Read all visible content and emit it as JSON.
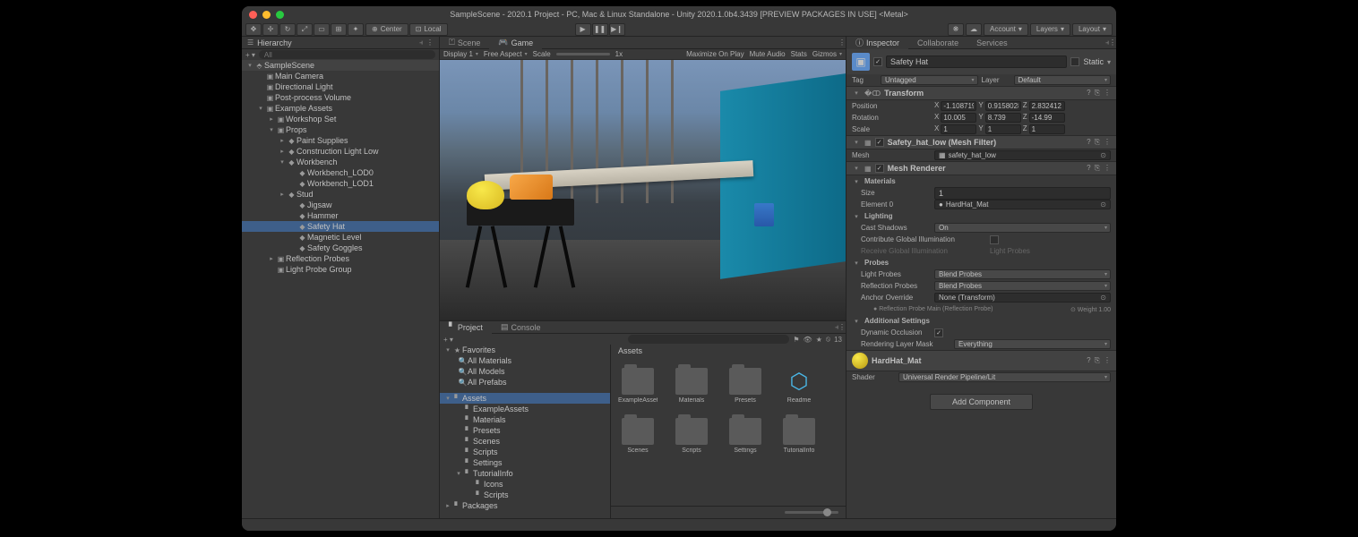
{
  "title": "SampleScene - 2020.1 Project - PC, Mac & Linux Standalone - Unity 2020.1.0b4.3439 [PREVIEW PACKAGES IN USE] <Metal>",
  "toolbar": {
    "center": "Center",
    "local": "Local",
    "account": "Account",
    "layers": "Layers",
    "layout": "Layout"
  },
  "hierarchy": {
    "title": "Hierarchy",
    "search_ph": "All",
    "items": [
      {
        "d": 0,
        "t": "▾",
        "i": "⬘",
        "l": "SampleScene",
        "hdr": true
      },
      {
        "d": 1,
        "t": "",
        "i": "▣",
        "l": "Main Camera"
      },
      {
        "d": 1,
        "t": "",
        "i": "▣",
        "l": "Directional Light"
      },
      {
        "d": 1,
        "t": "",
        "i": "▣",
        "l": "Post-process Volume"
      },
      {
        "d": 1,
        "t": "▾",
        "i": "▣",
        "l": "Example Assets"
      },
      {
        "d": 2,
        "t": "▸",
        "i": "▣",
        "l": "Workshop Set"
      },
      {
        "d": 2,
        "t": "▾",
        "i": "▣",
        "l": "Props"
      },
      {
        "d": 3,
        "t": "▸",
        "i": "◆",
        "l": "Paint Supplies"
      },
      {
        "d": 3,
        "t": "▸",
        "i": "◆",
        "l": "Construction Light Low"
      },
      {
        "d": 3,
        "t": "▾",
        "i": "◆",
        "l": "Workbench"
      },
      {
        "d": 4,
        "t": "",
        "i": "◆",
        "l": "Workbench_LOD0"
      },
      {
        "d": 4,
        "t": "",
        "i": "◆",
        "l": "Workbench_LOD1"
      },
      {
        "d": 3,
        "t": "▸",
        "i": "◆",
        "l": "Stud"
      },
      {
        "d": 4,
        "t": "",
        "i": "◆",
        "l": "Jigsaw"
      },
      {
        "d": 4,
        "t": "",
        "i": "◆",
        "l": "Hammer"
      },
      {
        "d": 4,
        "t": "",
        "i": "◆",
        "l": "Safety Hat",
        "sel": true
      },
      {
        "d": 4,
        "t": "",
        "i": "◆",
        "l": "Magnetic Level"
      },
      {
        "d": 4,
        "t": "",
        "i": "◆",
        "l": "Safety Goggles"
      },
      {
        "d": 2,
        "t": "▸",
        "i": "▣",
        "l": "Reflection Probes"
      },
      {
        "d": 2,
        "t": "",
        "i": "▣",
        "l": "Light Probe Group"
      }
    ]
  },
  "scene": {
    "tab_scene": "Scene",
    "tab_game": "Game",
    "display": "Display 1",
    "aspect": "Free Aspect",
    "scale": "Scale",
    "scale_val": "1x",
    "maximize": "Maximize On Play",
    "mute": "Mute Audio",
    "stats": "Stats",
    "gizmos": "Gizmos"
  },
  "project": {
    "tab_project": "Project",
    "tab_console": "Console",
    "count": "13",
    "favorites": "Favorites",
    "fav_items": [
      "All Materials",
      "All Models",
      "All Prefabs"
    ],
    "tree": [
      {
        "d": 0,
        "t": "▾",
        "i": "▘",
        "l": "Assets",
        "sel": true
      },
      {
        "d": 1,
        "t": "",
        "i": "▘",
        "l": "ExampleAssets"
      },
      {
        "d": 1,
        "t": "",
        "i": "▘",
        "l": "Materials"
      },
      {
        "d": 1,
        "t": "",
        "i": "▘",
        "l": "Presets"
      },
      {
        "d": 1,
        "t": "",
        "i": "▘",
        "l": "Scenes"
      },
      {
        "d": 1,
        "t": "",
        "i": "▘",
        "l": "Scripts"
      },
      {
        "d": 1,
        "t": "",
        "i": "▘",
        "l": "Settings"
      },
      {
        "d": 1,
        "t": "▾",
        "i": "▘",
        "l": "TutorialInfo"
      },
      {
        "d": 2,
        "t": "",
        "i": "▘",
        "l": "Icons"
      },
      {
        "d": 2,
        "t": "",
        "i": "▘",
        "l": "Scripts"
      },
      {
        "d": 0,
        "t": "▸",
        "i": "▘",
        "l": "Packages"
      }
    ],
    "assets_hdr": "Assets",
    "grid": [
      {
        "l": "ExampleAssets",
        "k": "folder"
      },
      {
        "l": "Materials",
        "k": "folder"
      },
      {
        "l": "Presets",
        "k": "folder"
      },
      {
        "l": "Readme",
        "k": "cube"
      },
      {
        "l": "Scenes",
        "k": "folder"
      },
      {
        "l": "Scripts",
        "k": "folder"
      },
      {
        "l": "Settings",
        "k": "folder"
      },
      {
        "l": "TutorialInfo",
        "k": "folder"
      }
    ]
  },
  "inspector": {
    "tab_inspector": "Inspector",
    "tab_collab": "Collaborate",
    "tab_services": "Services",
    "name": "Safety Hat",
    "static": "Static",
    "tag_lbl": "Tag",
    "tag": "Untagged",
    "layer_lbl": "Layer",
    "layer": "Default",
    "transform": {
      "title": "Transform",
      "pos_lbl": "Position",
      "pos": {
        "x": "-1.108719",
        "y": "0.9158028",
        "z": "2.832412"
      },
      "rot_lbl": "Rotation",
      "rot": {
        "x": "10.005",
        "y": "8.739",
        "z": "-14.99"
      },
      "scl_lbl": "Scale",
      "scl": {
        "x": "1",
        "y": "1",
        "z": "1"
      }
    },
    "meshfilter": {
      "title": "Safety_hat_low (Mesh Filter)",
      "mesh_lbl": "Mesh",
      "mesh": "safety_hat_low"
    },
    "renderer": {
      "title": "Mesh Renderer",
      "materials": "Materials",
      "size_lbl": "Size",
      "size": "1",
      "el0_lbl": "Element 0",
      "el0": "HardHat_Mat",
      "lighting": "Lighting",
      "cast_lbl": "Cast Shadows",
      "cast": "On",
      "cgi_lbl": "Contribute Global Illumination",
      "rgi_lbl": "Receive Global Illumination",
      "rgi": "Light Probes",
      "probes": "Probes",
      "lp_lbl": "Light Probes",
      "lp": "Blend Probes",
      "rp_lbl": "Reflection Probes",
      "rp": "Blend Probes",
      "ao_lbl": "Anchor Override",
      "ao": "None (Transform)",
      "rpm": "Reflection Probe Main (Reflection Probe)",
      "weight": "Weight 1.00",
      "additional": "Additional Settings",
      "do_lbl": "Dynamic Occlusion",
      "rlm_lbl": "Rendering Layer Mask",
      "rlm": "Everything"
    },
    "material": {
      "title": "HardHat_Mat",
      "shader_lbl": "Shader",
      "shader": "Universal Render Pipeline/Lit"
    },
    "add": "Add Component"
  }
}
